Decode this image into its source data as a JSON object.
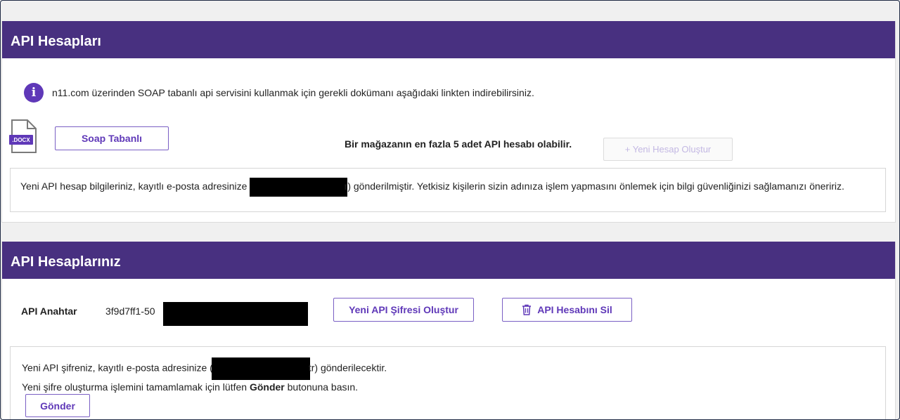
{
  "panel1": {
    "title": "API Hesapları",
    "info_text": "n11.com üzerinden SOAP tabanlı api servisini kullanmak için gerekli dokümanı aşağıdaki linkten indirebilirsiniz.",
    "doc_badge": ".DOCX",
    "soap_button": "Soap Tabanlı",
    "limit_text": "Bir mağazanın en fazla 5 adet API hesabı olabilir.",
    "create_button": "+ Yeni Hesap Oluştur",
    "notice_before": "Yeni API hesap bilgileriniz, kayıtlı e-posta adresinize (r",
    "notice_after": "r) gönderilmiştir. Yetkisiz kişilerin sizin adınıza işlem yapmasını önlemek için bilgi güvenliğinizi sağlamanızı öneririz."
  },
  "panel2": {
    "title": "API Hesaplarınız",
    "api_key_label": "API Anahtar",
    "api_key_value": "3f9d7ff1-50",
    "new_password_button": "Yeni API Şifresi Oluştur",
    "delete_button": "API Hesabını Sil",
    "notice_line1_before": "Yeni API şifreniz, kayıtlı e-posta adresinize (",
    "notice_line1_after": "tr) gönderilecektir.",
    "notice_line2_before": "Yeni şifre oluşturma işlemini tamamlamak için lütfen ",
    "notice_line2_bold": "Gönder",
    "notice_line2_after": " butonuna basın.",
    "send_button": "Gönder"
  },
  "colors": {
    "header_bg": "#483080",
    "accent": "#5f38b8"
  },
  "icons": [
    "info-icon",
    "docx-file-icon",
    "trash-icon"
  ]
}
